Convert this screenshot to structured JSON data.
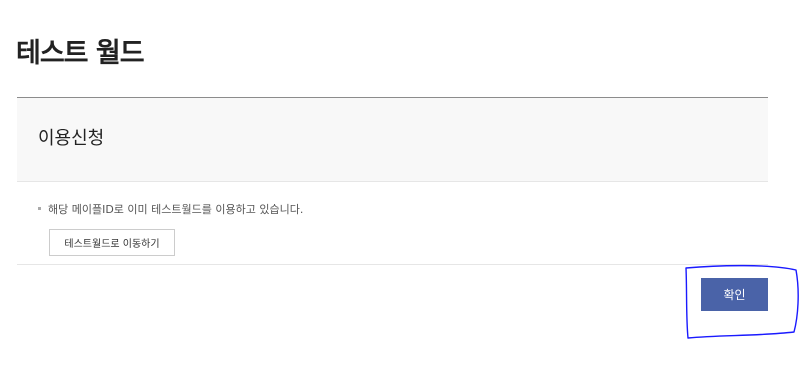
{
  "page": {
    "title": "테스트 월드"
  },
  "panel": {
    "title": "이용신청",
    "notice": "해당 메이플ID로 이미 테스트월드를 이용하고 있습니다.",
    "go_button_label": "테스트월드로 이동하기"
  },
  "footer": {
    "confirm_label": "확인"
  },
  "colors": {
    "confirm_button": "#4a63a8",
    "annotation_stroke": "#1a1aff",
    "panel_header_bg": "#f8f8f8"
  }
}
